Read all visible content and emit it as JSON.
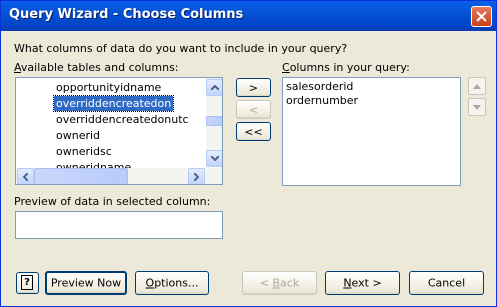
{
  "window": {
    "title": "Query Wizard - Choose Columns"
  },
  "prompt": "What columns of data do you want to include in your query?",
  "available": {
    "label_accel": "A",
    "label_rest": "vailable tables and columns:",
    "items": [
      "opportunityidname",
      "overriddencreatedon",
      "overriddencreatedonutc",
      "ownerid",
      "owneridsc",
      "owneridname"
    ],
    "selected": "overriddencreatedon"
  },
  "query": {
    "label_accel": "C",
    "label_rest": "olumns in your query:",
    "items": [
      "salesorderid",
      "ordernumber"
    ]
  },
  "move_buttons": {
    "add": ">",
    "remove": "<",
    "remove_all": "<<"
  },
  "preview": {
    "label": "Preview of data in selected column:",
    "value": ""
  },
  "buttons": {
    "preview_now": "Preview Now",
    "options_accel": "O",
    "options_rest": "ptions...",
    "back_pre": "< ",
    "back_accel": "B",
    "back_rest": "ack",
    "next_accel": "N",
    "next_rest": "ext >",
    "cancel": "Cancel"
  },
  "state": {
    "back_enabled": false,
    "remove_enabled": false,
    "reorder_enabled": false
  }
}
